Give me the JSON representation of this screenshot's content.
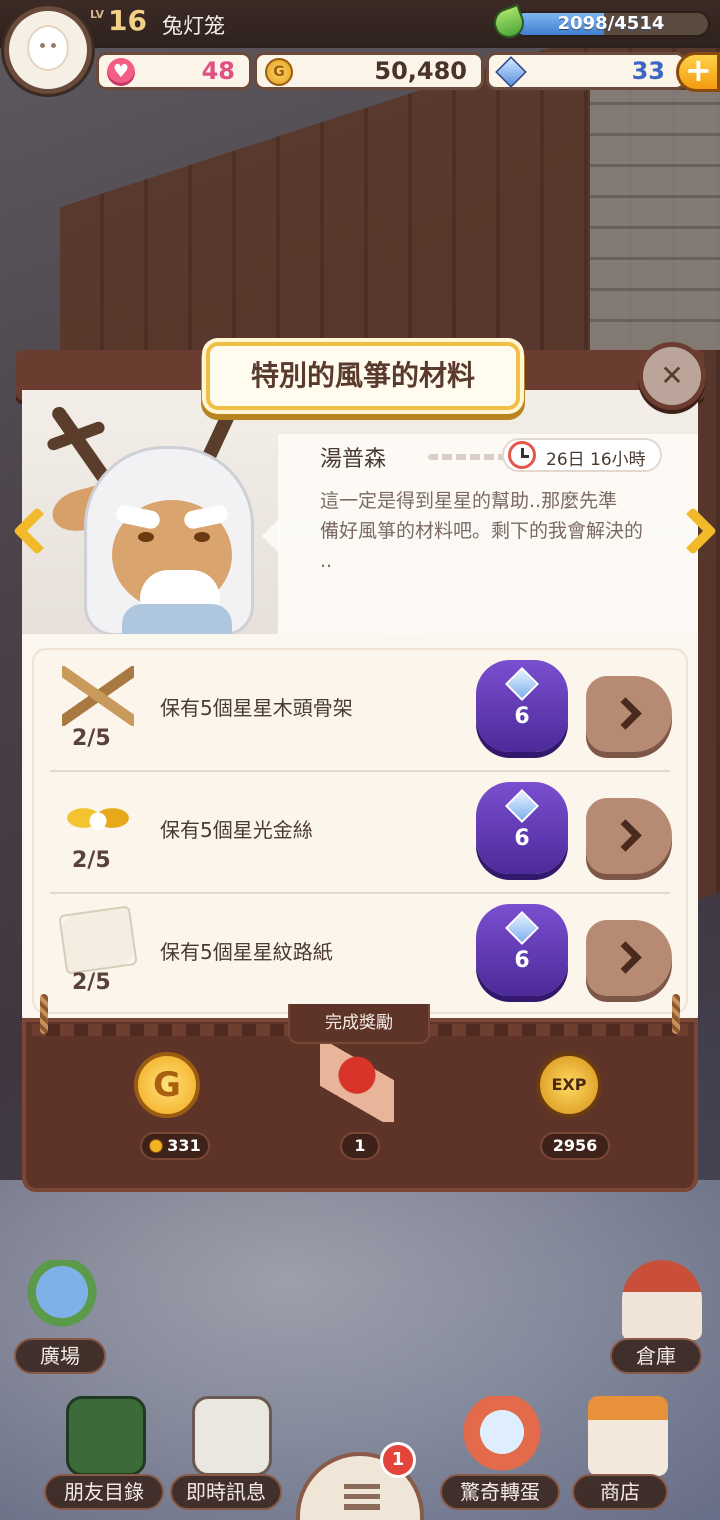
{
  "player": {
    "level_prefix": "LV",
    "level": "16",
    "name": "兔灯笼",
    "exp_text": "2098/4514",
    "exp_progress": 0.465
  },
  "resources": {
    "hearts": "48",
    "gold": "50,480",
    "gems": "33"
  },
  "dialog": {
    "title": "特別的風箏的材料",
    "npc_name": "湯普森",
    "timer": "26日 16小時",
    "npc_text": "這一定是得到星星的幫助..那麼先準\n備好風箏的材料吧。剩下的我會解決的\n..",
    "tasks": [
      {
        "icon": "wood-sticks-icon",
        "label": "保有5個星星木頭骨架",
        "progress": "2/5",
        "cost": "6"
      },
      {
        "icon": "gold-ribbon-icon",
        "label": "保有5個星光金絲",
        "progress": "2/5",
        "cost": "6"
      },
      {
        "icon": "star-paper-icon",
        "label": "保有5個星星紋路紙",
        "progress": "2/5",
        "cost": "6"
      }
    ],
    "reward_title": "完成獎勵",
    "rewards": {
      "gold": "331",
      "scroll": "1",
      "exp": "2956"
    }
  },
  "bottom_nav": {
    "plaza": "廣場",
    "warehouse": "倉庫",
    "friends": "朋友目錄",
    "chat": "即時訊息",
    "gacha": "驚奇轉蛋",
    "shop": "商店",
    "menu_badge": "1"
  },
  "colors": {
    "accent_gold": "#f2b92a",
    "purple_button": "#5b34b0",
    "dialog_brown": "#6a3d30",
    "exp_blue": "#4f8fdc"
  }
}
